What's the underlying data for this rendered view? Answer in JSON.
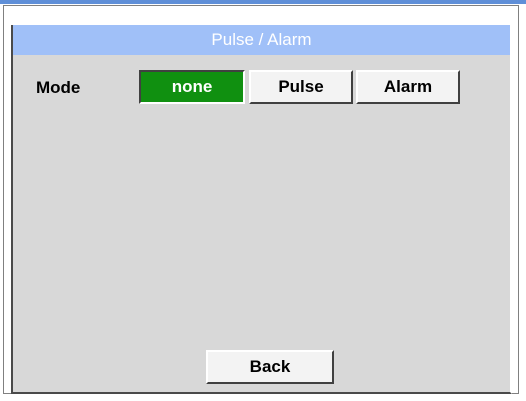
{
  "title": "Pulse / Alarm",
  "mode": {
    "label": "Mode",
    "options": [
      "none",
      "Pulse",
      "Alarm"
    ],
    "selected": "none"
  },
  "footer": {
    "back_label": "Back"
  },
  "colors": {
    "title_bar": "#a0c0f8",
    "selected_button": "#109010",
    "panel_background": "#d8d8d8"
  }
}
